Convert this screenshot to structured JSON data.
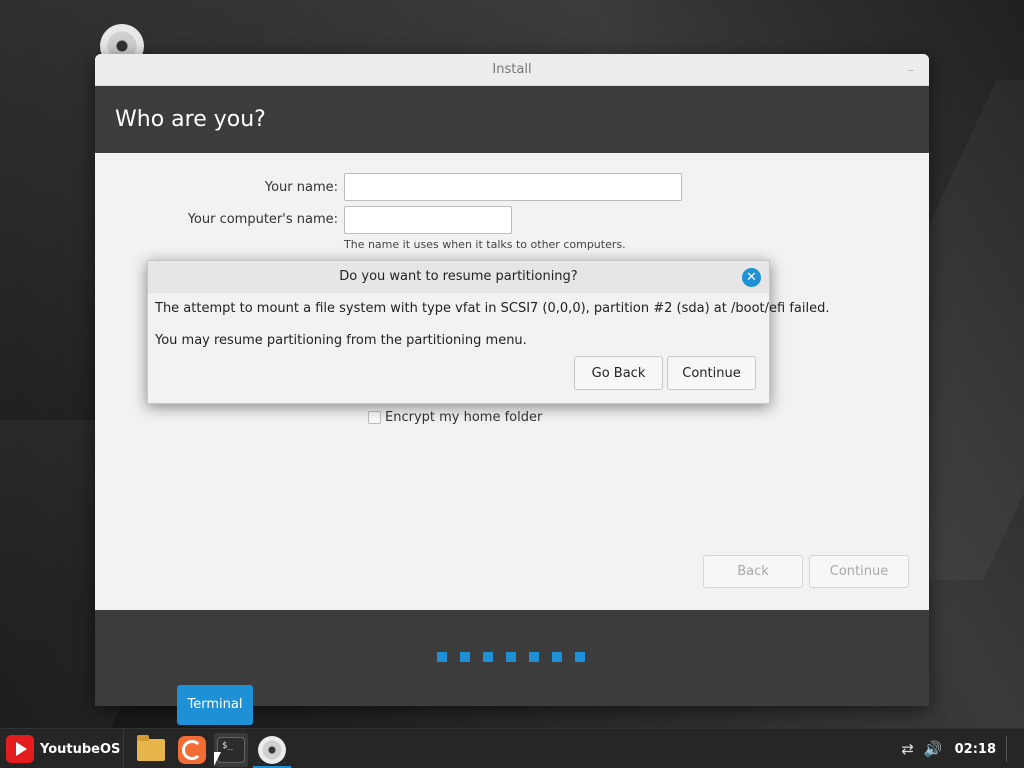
{
  "window": {
    "title": "Install",
    "minimize_label": "–"
  },
  "header": {
    "title": "Who are you?"
  },
  "form": {
    "name_label": "Your name:",
    "name_value": "",
    "computer_label": "Your computer's name:",
    "computer_value": "",
    "computer_hint": "The name it uses when it talks to other computers.",
    "encrypt_label": "Encrypt my home folder",
    "encrypt_checked": false
  },
  "nav": {
    "back_label": "Back",
    "continue_label": "Continue"
  },
  "progress": {
    "total_steps": 7
  },
  "dialog": {
    "title": "Do you want to resume partitioning?",
    "close_glyph": "✕",
    "message1": "The attempt to mount a file system with type vfat in SCSI7 (0,0,0), partition #2 (sda) at /boot/efi failed.",
    "message2": "You may resume partitioning from the partitioning menu.",
    "go_back_label": "Go Back",
    "continue_label": "Continue"
  },
  "tooltip": {
    "text": "Terminal"
  },
  "taskbar": {
    "menu_label": "YoutubeOS",
    "terminal_prompt": "$_",
    "clock": "02:18",
    "network_glyph": "⇄",
    "volume_glyph": "🔊"
  },
  "colors": {
    "accent": "#1e90d5",
    "header_bg": "#3c3c3c",
    "brand_red": "#e31d1d"
  }
}
